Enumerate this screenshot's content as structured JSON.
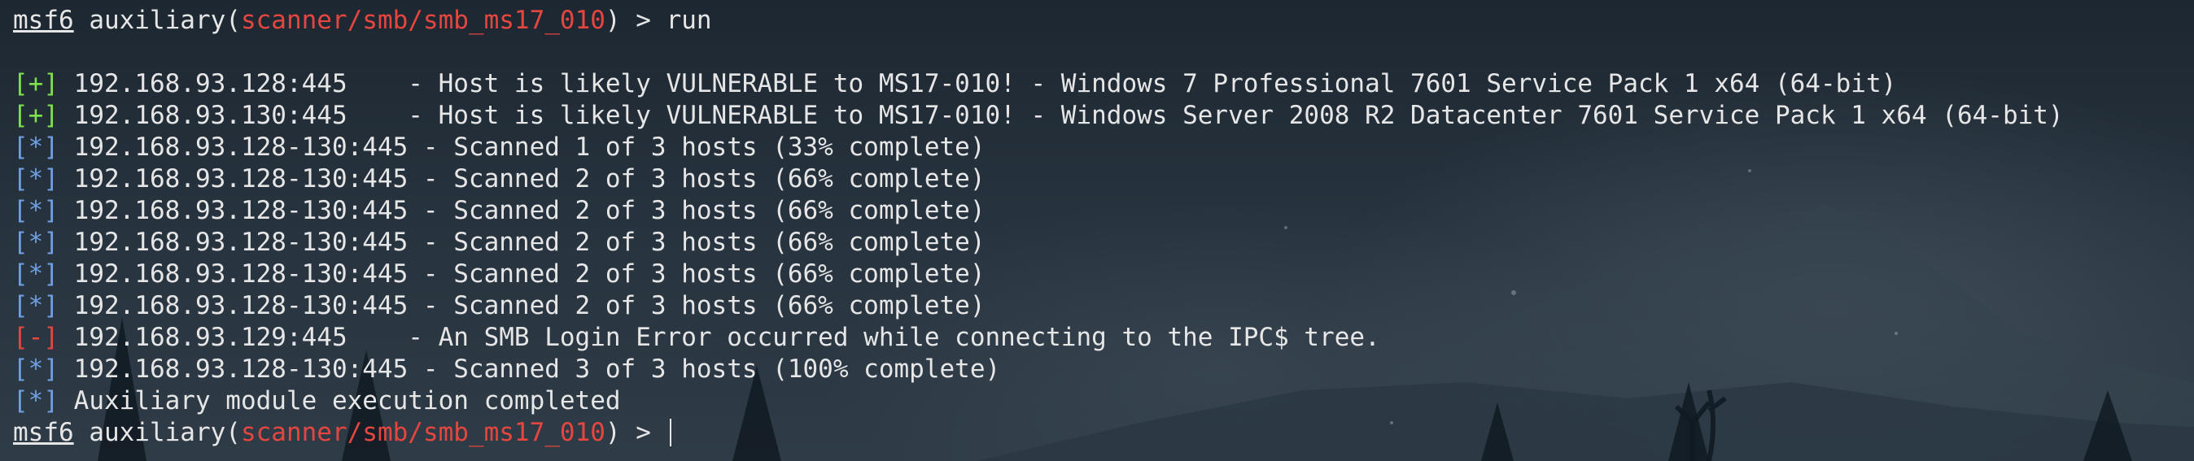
{
  "prompt": {
    "msf": "msf6",
    "pre": " auxiliary(",
    "module": "scanner/smb/smb_ms17_010",
    "post": ") > ",
    "command": "run"
  },
  "lines": [
    {
      "tag": "[+]",
      "text": " 192.168.93.128:445    - Host is likely VULNERABLE to MS17-010! - Windows 7 Professional 7601 Service Pack 1 x64 (64-bit)"
    },
    {
      "tag": "[+]",
      "text": " 192.168.93.130:445    - Host is likely VULNERABLE to MS17-010! - Windows Server 2008 R2 Datacenter 7601 Service Pack 1 x64 (64-bit)"
    },
    {
      "tag": "[*]",
      "text": " 192.168.93.128-130:445 - Scanned 1 of 3 hosts (33% complete)"
    },
    {
      "tag": "[*]",
      "text": " 192.168.93.128-130:445 - Scanned 2 of 3 hosts (66% complete)"
    },
    {
      "tag": "[*]",
      "text": " 192.168.93.128-130:445 - Scanned 2 of 3 hosts (66% complete)"
    },
    {
      "tag": "[*]",
      "text": " 192.168.93.128-130:445 - Scanned 2 of 3 hosts (66% complete)"
    },
    {
      "tag": "[*]",
      "text": " 192.168.93.128-130:445 - Scanned 2 of 3 hosts (66% complete)"
    },
    {
      "tag": "[*]",
      "text": " 192.168.93.128-130:445 - Scanned 2 of 3 hosts (66% complete)"
    },
    {
      "tag": "[-]",
      "text": " 192.168.93.129:445    - An SMB Login Error occurred while connecting to the IPC$ tree."
    },
    {
      "tag": "[*]",
      "text": " 192.168.93.128-130:445 - Scanned 3 of 3 hosts (100% complete)"
    },
    {
      "tag": "[*]",
      "text": " Auxiliary module execution completed"
    }
  ],
  "colors": {
    "success": "#7ee04d",
    "info": "#6f9fe0",
    "error": "#e5463f",
    "module": "#e5463f",
    "text": "#e6e6e6"
  }
}
